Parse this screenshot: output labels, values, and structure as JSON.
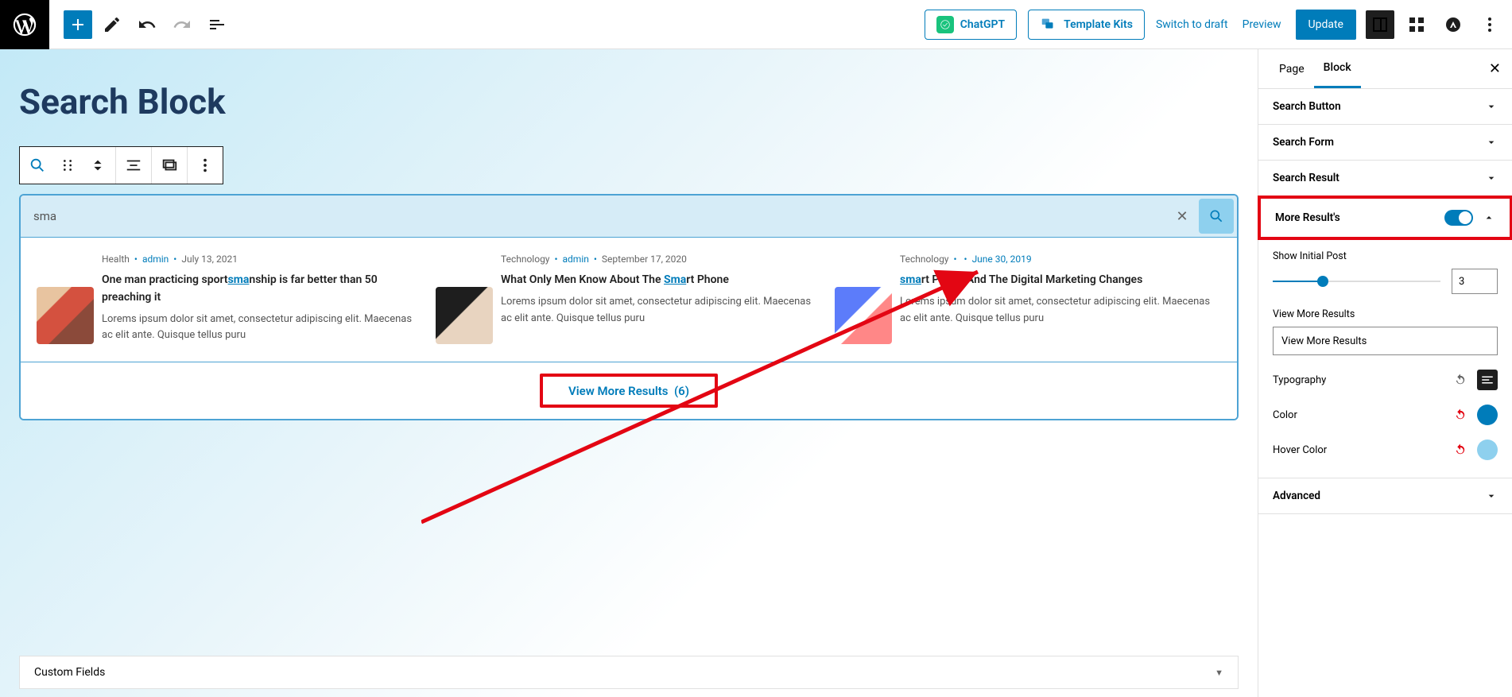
{
  "topbar": {
    "chatgpt": "ChatGPT",
    "template_kits": "Template Kits",
    "switch_to_draft": "Switch to draft",
    "preview": "Preview",
    "update": "Update"
  },
  "canvas": {
    "page_title": "Search Block",
    "search_value": "sma",
    "view_more_label": "View More Results",
    "view_more_count": "(6)",
    "custom_fields": "Custom Fields"
  },
  "results": [
    {
      "cat": "Health",
      "author": "admin",
      "date": "July 13, 2021",
      "title_pre": "One man practicing sport",
      "title_hl": "sma",
      "title_post": "nship is far better than 50 preaching it",
      "excerpt": "Lorems ipsum dolor sit amet, consectetur adipiscing elit. Maecenas ac elit ante. Quisque tellus puru"
    },
    {
      "cat": "Technology",
      "author": "admin",
      "date": "September 17, 2020",
      "title_pre": "What Only Men Know About The ",
      "title_hl": "Sma",
      "title_post": "rt Phone",
      "excerpt": "Lorems ipsum dolor sit amet, consectetur adipiscing elit. Maecenas ac elit ante. Quisque tellus puru"
    },
    {
      "cat": "Technology",
      "author": "",
      "date": "June 30, 2019",
      "title_pre": "",
      "title_hl": "sma",
      "title_post": "rt Phone And The Digital Marketing Changes",
      "excerpt": "Lorems ipsum dolor sit amet, consectetur adipiscing elit. Maecenas ac elit ante. Quisque tellus puru"
    }
  ],
  "sidebar": {
    "tabs": {
      "page": "Page",
      "block": "Block"
    },
    "sections": {
      "search_button": "Search Button",
      "search_form": "Search Form",
      "search_result": "Search Result",
      "more_results": "More Result's",
      "advanced": "Advanced"
    },
    "body": {
      "show_initial": "Show Initial Post",
      "show_initial_val": "3",
      "view_more_label": "View More Results",
      "view_more_value": "View More Results",
      "typography": "Typography",
      "color": "Color",
      "color_value": "#007cba",
      "hover_color": "Hover Color",
      "hover_color_value": "#8ed0ee"
    }
  }
}
